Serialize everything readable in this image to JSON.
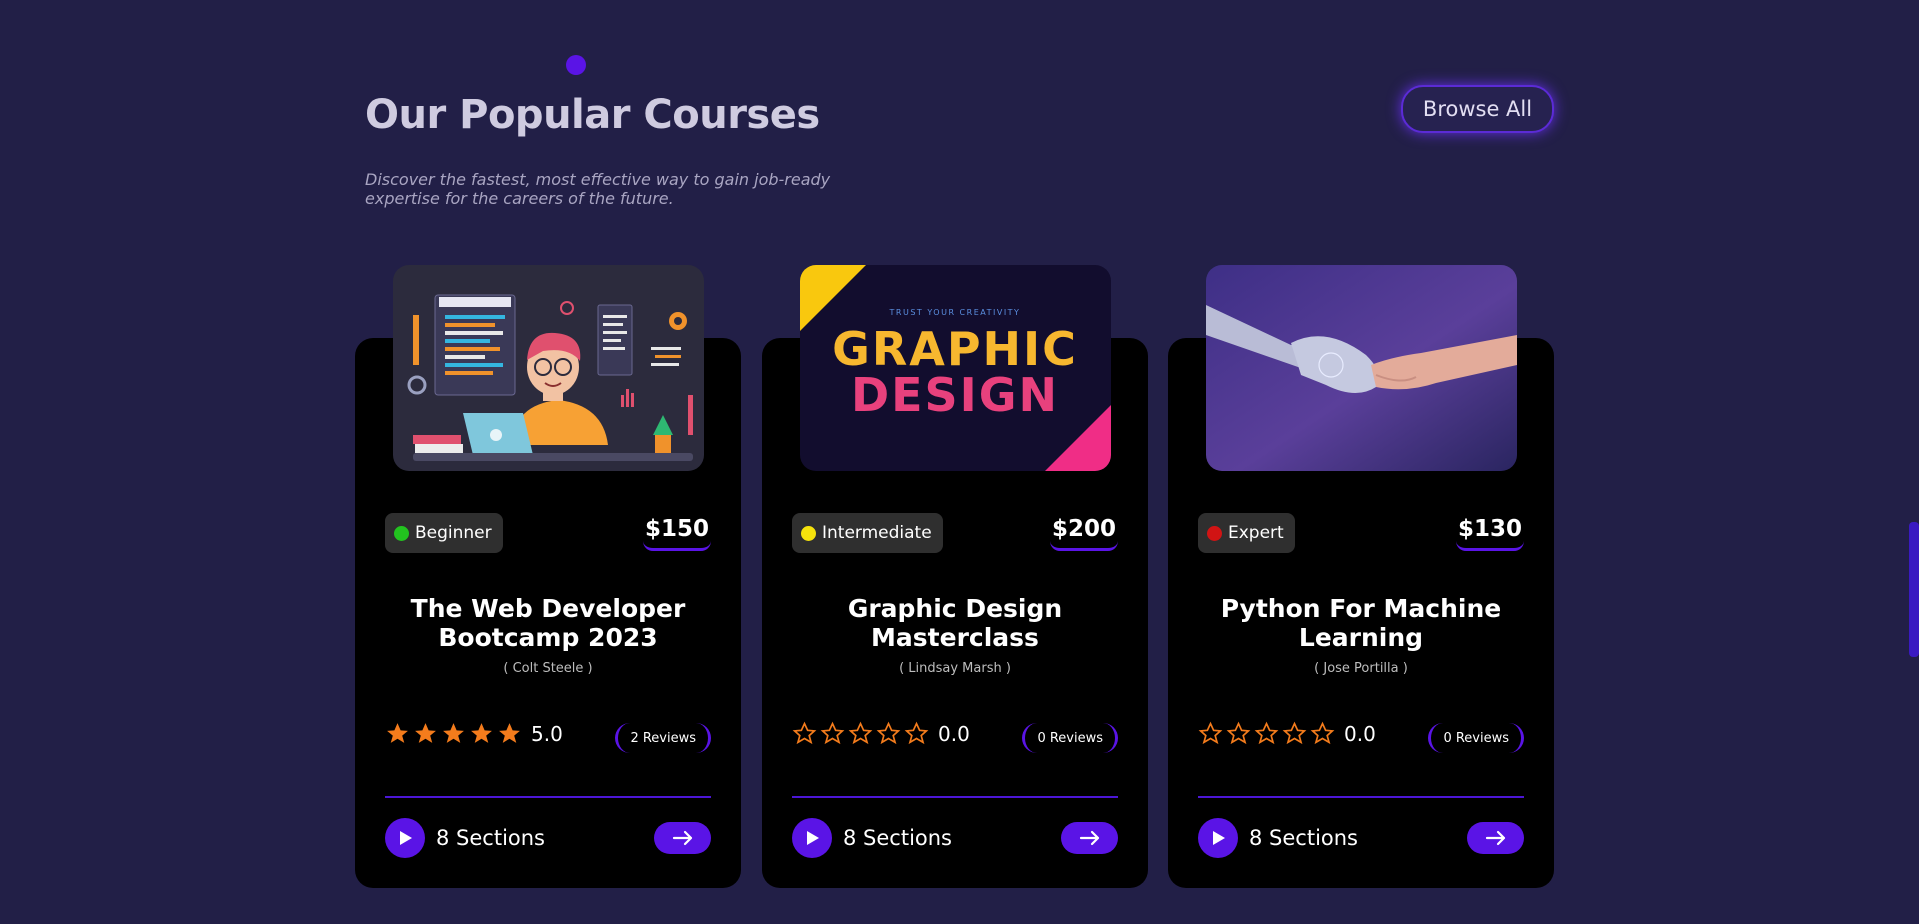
{
  "header": {
    "title": "Our Popular Courses",
    "description": "Discover the fastest, most effective way to gain job-ready expertise for the careers of the future.",
    "browse_label": "Browse All"
  },
  "colors": {
    "background": "#221f47",
    "card": "#000000",
    "accent": "#5a14e6",
    "star": "#f47c1c",
    "beginner": "#22c31f",
    "intermediate": "#f5e20c",
    "expert": "#d11414"
  },
  "courses": [
    {
      "level": "Beginner",
      "level_color": "#22c31f",
      "price": "$150",
      "title": "The Web Developer Bootcamp 2023",
      "instructor": "( Colt Steele )",
      "rating": 5,
      "rating_text": "5.0",
      "reviews": "2 Reviews",
      "sections": "8 Sections",
      "image_icon": "web-developer-illustration"
    },
    {
      "level": "Intermediate",
      "level_color": "#f5e20c",
      "price": "$200",
      "title": "Graphic Design Masterclass",
      "instructor": "( Lindsay Marsh )",
      "rating": 0,
      "rating_text": "0.0",
      "reviews": "0 Reviews",
      "sections": "8 Sections",
      "image_icon": "graphic-design-banner",
      "image_tagline": "TRUST YOUR CREATIVITY",
      "image_line1": "GRAPHIC",
      "image_line2": "DESIGN"
    },
    {
      "level": "Expert",
      "level_color": "#d11414",
      "price": "$130",
      "title": "Python For Machine Learning",
      "instructor": "( Jose Portilla )",
      "rating": 0,
      "rating_text": "0.0",
      "reviews": "0 Reviews",
      "sections": "8 Sections",
      "image_icon": "robot-handshake-photo"
    }
  ]
}
